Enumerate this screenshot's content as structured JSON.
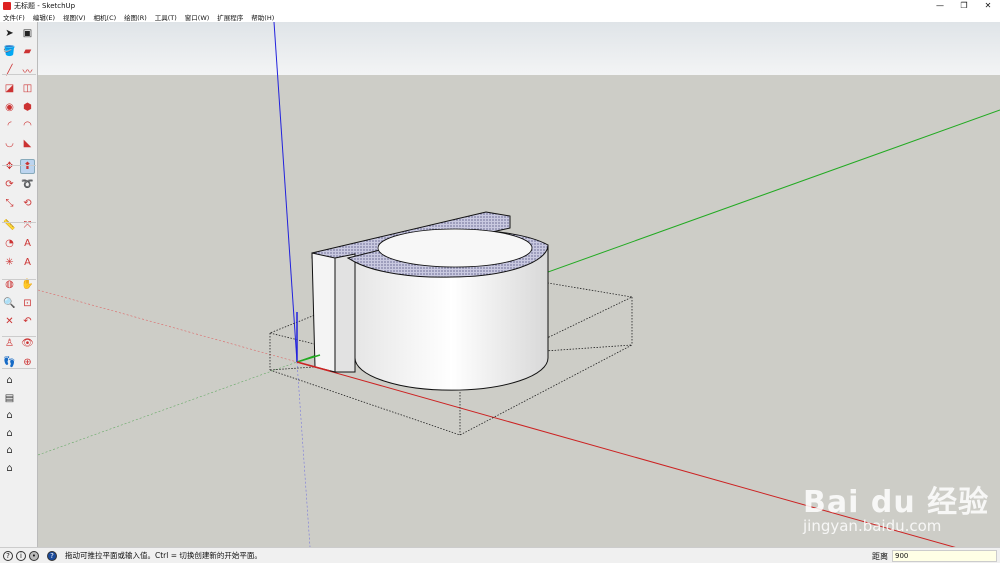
{
  "window": {
    "title": "无标题 - SketchUp",
    "minimize": "—",
    "restore": "❐",
    "close": "✕"
  },
  "menu": [
    "文件(F)",
    "编辑(E)",
    "视图(V)",
    "相机(C)",
    "绘图(R)",
    "工具(T)",
    "窗口(W)",
    "扩展程序",
    "帮助(H)"
  ],
  "tools": [
    {
      "name": "select",
      "g": "➤"
    },
    {
      "name": "make-component",
      "g": "▣"
    },
    {
      "name": "paint-bucket",
      "g": "🪣"
    },
    {
      "name": "eraser",
      "g": "▰"
    },
    {
      "name": "line",
      "g": "╱"
    },
    {
      "name": "freehand",
      "g": "〰"
    },
    {
      "name": "rectangle",
      "g": "◪"
    },
    {
      "name": "rotated-rectangle",
      "g": "◫"
    },
    {
      "name": "circle",
      "g": "◉"
    },
    {
      "name": "polygon",
      "g": "⬢"
    },
    {
      "name": "arc",
      "g": "◜"
    },
    {
      "name": "two-point-arc",
      "g": "◠"
    },
    {
      "name": "three-point-arc",
      "g": "◡"
    },
    {
      "name": "pie",
      "g": "◣"
    },
    {
      "name": "move",
      "g": "✥"
    },
    {
      "name": "push-pull",
      "g": "⬆",
      "active": true
    },
    {
      "name": "rotate",
      "g": "⟳"
    },
    {
      "name": "follow-me",
      "g": "➰"
    },
    {
      "name": "scale",
      "g": "⤡"
    },
    {
      "name": "offset",
      "g": "⟲"
    },
    {
      "name": "tape-measure",
      "g": "📏"
    },
    {
      "name": "dimension",
      "g": "⤧"
    },
    {
      "name": "protractor",
      "g": "◔"
    },
    {
      "name": "text",
      "g": "A"
    },
    {
      "name": "axes",
      "g": "✳"
    },
    {
      "name": "3d-text",
      "g": "A"
    },
    {
      "name": "orbit",
      "g": "◍"
    },
    {
      "name": "pan",
      "g": "✋"
    },
    {
      "name": "zoom",
      "g": "🔍"
    },
    {
      "name": "zoom-window",
      "g": "⊡"
    },
    {
      "name": "zoom-extents",
      "g": "✕"
    },
    {
      "name": "previous-view",
      "g": "↶"
    },
    {
      "name": "position-camera",
      "g": "♙"
    },
    {
      "name": "look-around",
      "g": "👁"
    },
    {
      "name": "walk",
      "g": "👣"
    },
    {
      "name": "section-plane",
      "g": "⊕"
    }
  ],
  "views": [
    {
      "name": "iso-view",
      "g": "⌂"
    },
    {
      "name": "top-view",
      "g": "▤"
    },
    {
      "name": "front-view",
      "g": "⌂"
    },
    {
      "name": "right-view",
      "g": "⌂"
    },
    {
      "name": "back-view",
      "g": "⌂"
    },
    {
      "name": "left-view",
      "g": "⌂"
    }
  ],
  "status": {
    "hint": "拖动可推拉平面或输入值。Ctrl = 切换创建新的开始平面。",
    "vcb_label": "距离",
    "vcb_value": "900"
  },
  "watermark": {
    "brand": "Bai du 经验",
    "url": "jingyan.baidu.com"
  },
  "colors": {
    "red_axis": "#d22",
    "green_axis": "#2a2",
    "blue_axis": "#22d"
  }
}
